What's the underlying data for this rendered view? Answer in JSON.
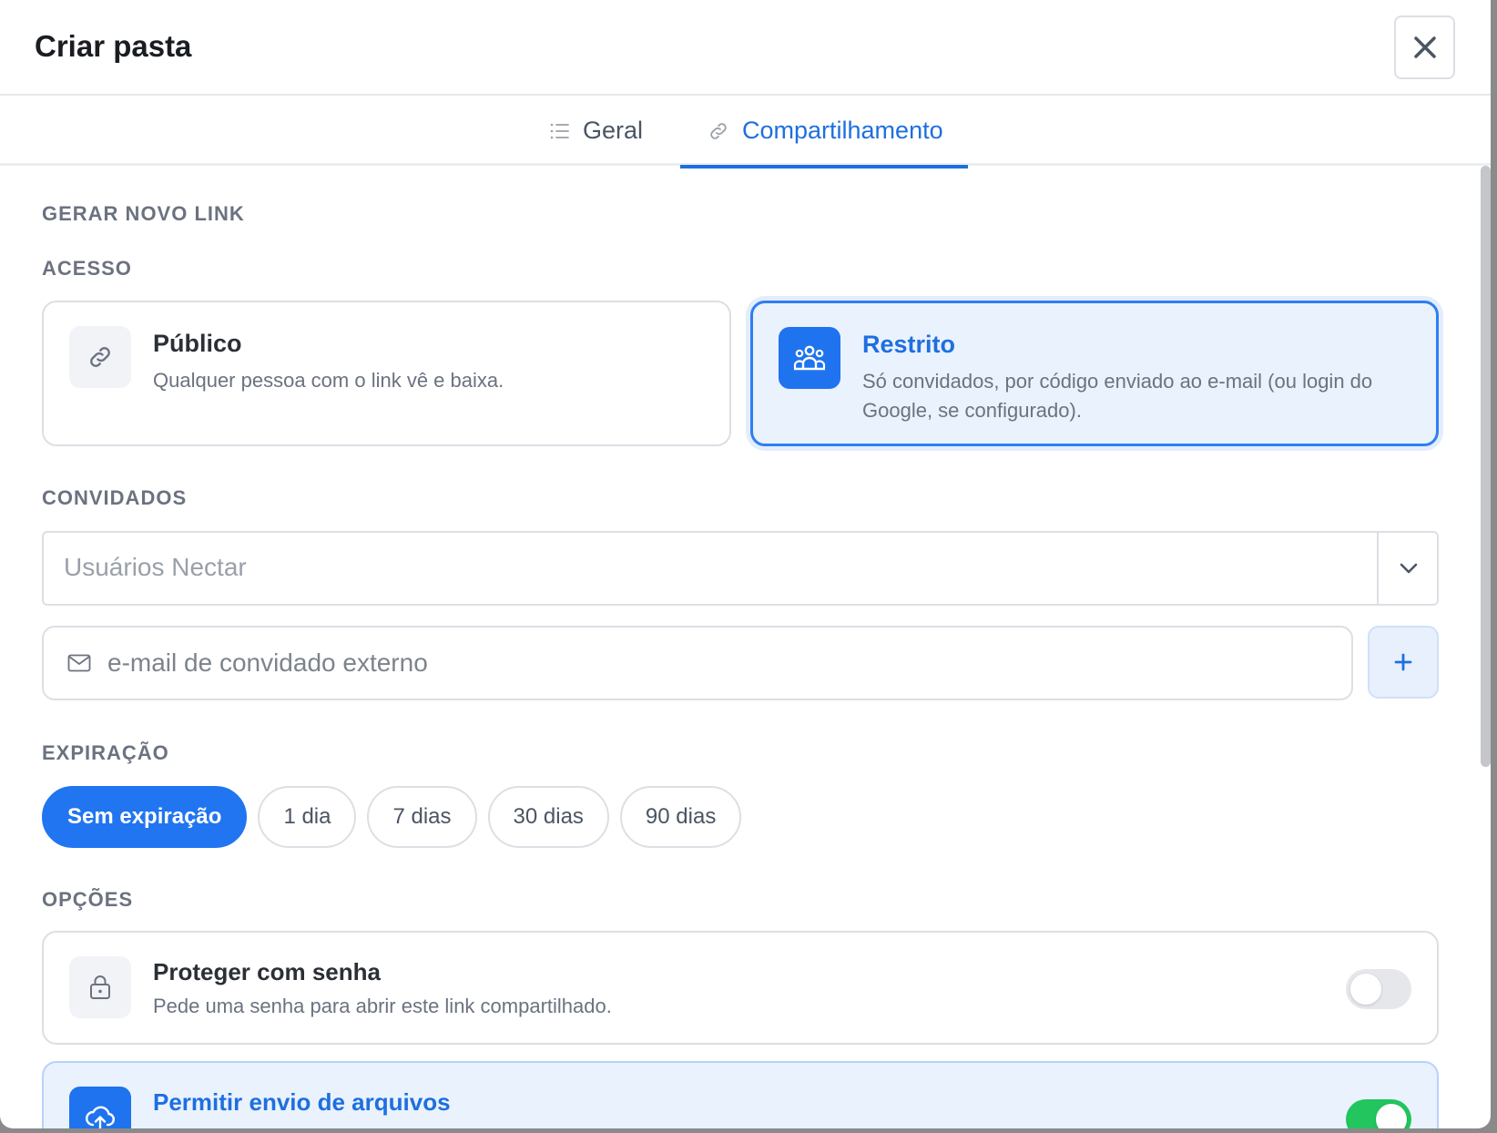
{
  "modal": {
    "title": "Criar pasta",
    "close_icon": "close-icon"
  },
  "tabs": [
    {
      "label": "Geral",
      "icon": "list-icon",
      "active": false
    },
    {
      "label": "Compartilhamento",
      "icon": "link-icon",
      "active": true
    }
  ],
  "sections": {
    "new_link": "GERAR NOVO LINK",
    "access": "ACESSO",
    "guests": "CONVIDADOS",
    "expiration": "EXPIRAÇÃO",
    "options": "OPÇÕES"
  },
  "access": {
    "publico": {
      "title": "Público",
      "desc": "Qualquer pessoa com o link vê e baixa.",
      "icon": "link-icon",
      "selected": false
    },
    "restrito": {
      "title": "Restrito",
      "desc": "Só convidados, por código enviado ao e-mail (ou login do Google, se configurado).",
      "icon": "users-icon",
      "selected": true
    }
  },
  "guests": {
    "select_placeholder": "Usuários Nectar",
    "email_placeholder": "e-mail de convidado externo",
    "add_label": "+"
  },
  "expiration": {
    "options": [
      "Sem expiração",
      "1 dia",
      "7 dias",
      "30 dias",
      "90 dias"
    ],
    "selected": "Sem expiração"
  },
  "options": {
    "password": {
      "title": "Proteger com senha",
      "desc": "Pede uma senha para abrir este link compartilhado.",
      "icon": "lock-icon",
      "enabled": false
    },
    "uploads": {
      "title": "Permitir envio de arquivos",
      "icon": "cloud-upload-icon",
      "enabled": true
    }
  },
  "colors": {
    "accent": "#1e6fe0",
    "toggle_on": "#22c55e",
    "selected_bg": "#eaf2fe"
  }
}
